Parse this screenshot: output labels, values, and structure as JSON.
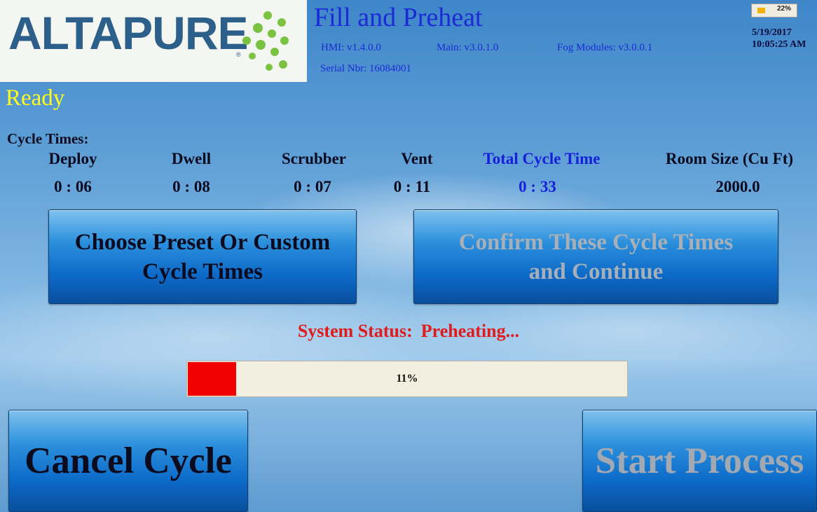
{
  "logo": {
    "text": "ALTAPURE",
    "reg": "®",
    "brand_color": "#2c5f8a",
    "dot_color": "#7bc142"
  },
  "header": {
    "title": "Fill and Preheat",
    "hmi": "HMI: v1.4.0.0",
    "main": "Main: v3.0.1.0",
    "fog": "Fog Modules: v3.0.0.1",
    "serial": "Serial  Nbr: 16084001"
  },
  "battery": {
    "label": "22%",
    "level": 0.22,
    "color": "#f2b300"
  },
  "datetime": {
    "date": "5/19/2017",
    "time": "10:05:25 AM"
  },
  "state": "Ready",
  "cycle": {
    "label": "Cycle Times:",
    "columns": [
      {
        "header": "Deploy",
        "value": "0 : 06"
      },
      {
        "header": "Dwell",
        "value": "0 : 08"
      },
      {
        "header": "Scrubber",
        "value": "0 : 07"
      },
      {
        "header": "Vent",
        "value": "0 : 11"
      },
      {
        "header": "Total Cycle Time",
        "value": "0  :  33"
      },
      {
        "header": "Room Size (Cu Ft)",
        "value": "2000.0"
      }
    ]
  },
  "buttons": {
    "choose_line1": "Choose Preset Or Custom",
    "choose_line2": "Cycle Times",
    "confirm_line1": "Confirm These Cycle Times",
    "confirm_line2": "and Continue",
    "cancel": "Cancel Cycle",
    "start": "Start Process"
  },
  "status": {
    "label": "System Status:",
    "value": "Preheating...",
    "color": "#e01b1b"
  },
  "progress": {
    "label": "11%",
    "value": 0.11,
    "fill_color": "#f20000"
  }
}
